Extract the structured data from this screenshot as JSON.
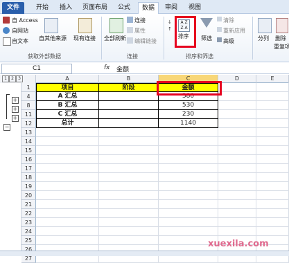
{
  "tabs": [
    "文件",
    "开始",
    "插入",
    "页面布局",
    "公式",
    "数据",
    "审阅",
    "视图"
  ],
  "ribbon": {
    "access": "自 Access",
    "web": "自网站",
    "text": "自文本",
    "other_sources": "自其他来源",
    "existing": "现有连接",
    "refresh_all": "全部刷新",
    "connections": "连接",
    "properties": "属性",
    "edit_links": "编辑链接",
    "sort": "排序",
    "filter": "筛选",
    "clear": "清除",
    "reapply": "重新应用",
    "advanced": "高级",
    "split": "分列",
    "remove": "删除",
    "remove2": "重复项",
    "group_get_external": "获取外部数据",
    "group_connections": "连接",
    "group_sort_filter": "排序和筛选"
  },
  "formula_bar": {
    "name_box": "C1",
    "fx": "fx",
    "content": "金额"
  },
  "outline_levels": [
    "1",
    "2",
    "3"
  ],
  "columns": [
    "A",
    "B",
    "C",
    "D",
    "E"
  ],
  "rows": [
    {
      "num": "1",
      "a": "项目",
      "b": "阶段",
      "c": "金额"
    },
    {
      "num": "4",
      "a": "A 汇总",
      "b": "",
      "c": "380"
    },
    {
      "num": "8",
      "a": "B 汇总",
      "b": "",
      "c": "530"
    },
    {
      "num": "11",
      "a": "C 汇总",
      "b": "",
      "c": "230"
    },
    {
      "num": "12",
      "a": "总计",
      "b": "",
      "c": "1140"
    },
    {
      "num": "13"
    },
    {
      "num": "14"
    },
    {
      "num": "15"
    },
    {
      "num": "16"
    },
    {
      "num": "17"
    },
    {
      "num": "18"
    },
    {
      "num": "19"
    },
    {
      "num": "20"
    },
    {
      "num": "21"
    },
    {
      "num": "22"
    },
    {
      "num": "23"
    },
    {
      "num": "24"
    },
    {
      "num": "25"
    },
    {
      "num": "26"
    },
    {
      "num": "27"
    }
  ],
  "watermark": "xuexila.com",
  "colors": {
    "header_fill": "#ffff00",
    "highlight": "#e6001e",
    "file_tab": "#2a5fac"
  }
}
